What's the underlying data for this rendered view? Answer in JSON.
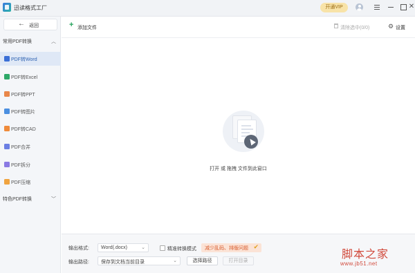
{
  "app": {
    "title": "迅读格式工厂",
    "vip_label": "开通VIP"
  },
  "sidebar": {
    "back_label": "返回",
    "group1": {
      "title": "常用PDF转换",
      "chevron": "^"
    },
    "items": [
      {
        "label": "PDF转Word",
        "icon": "word-icon",
        "color": "#3b6fd6",
        "active": true
      },
      {
        "label": "PDF转Excel",
        "icon": "excel-icon",
        "color": "#2da868",
        "active": false
      },
      {
        "label": "PDF转PPT",
        "icon": "ppt-icon",
        "color": "#e8874a",
        "active": false
      },
      {
        "label": "PDF转图片",
        "icon": "image-icon",
        "color": "#4b8fe0",
        "active": false
      },
      {
        "label": "PDF转CAD",
        "icon": "cad-icon",
        "color": "#ef8b3b",
        "active": false
      },
      {
        "label": "PDF合并",
        "icon": "merge-icon",
        "color": "#6b7fe3",
        "active": false
      },
      {
        "label": "PDF拆分",
        "icon": "split-icon",
        "color": "#8a7ae3",
        "active": false
      },
      {
        "label": "PDF压缩",
        "icon": "compress-icon",
        "color": "#f0a440",
        "active": false
      }
    ],
    "group2": {
      "title": "特色PDF转换",
      "chevron": "v"
    }
  },
  "toolbar": {
    "add_file_label": "添加文件",
    "clear_selected_label": "清除选中(0/0)",
    "settings_label": "设置"
  },
  "drop_area": {
    "text": "打开 或 拖拽 文件到此窗口"
  },
  "bottom": {
    "output_format_label": "输出格式:",
    "output_format_value": "Word(.docx)",
    "precise_mode_label": "精准转换模式",
    "promo_label": "减少乱码、排版问题",
    "output_path_label": "输出路径:",
    "output_path_value": "保存到文档当前目录",
    "choose_path_label": "选择路径",
    "open_dir_label": "打开目录"
  },
  "watermark": {
    "title": "脚本之家",
    "url": "www.jb51.net"
  }
}
